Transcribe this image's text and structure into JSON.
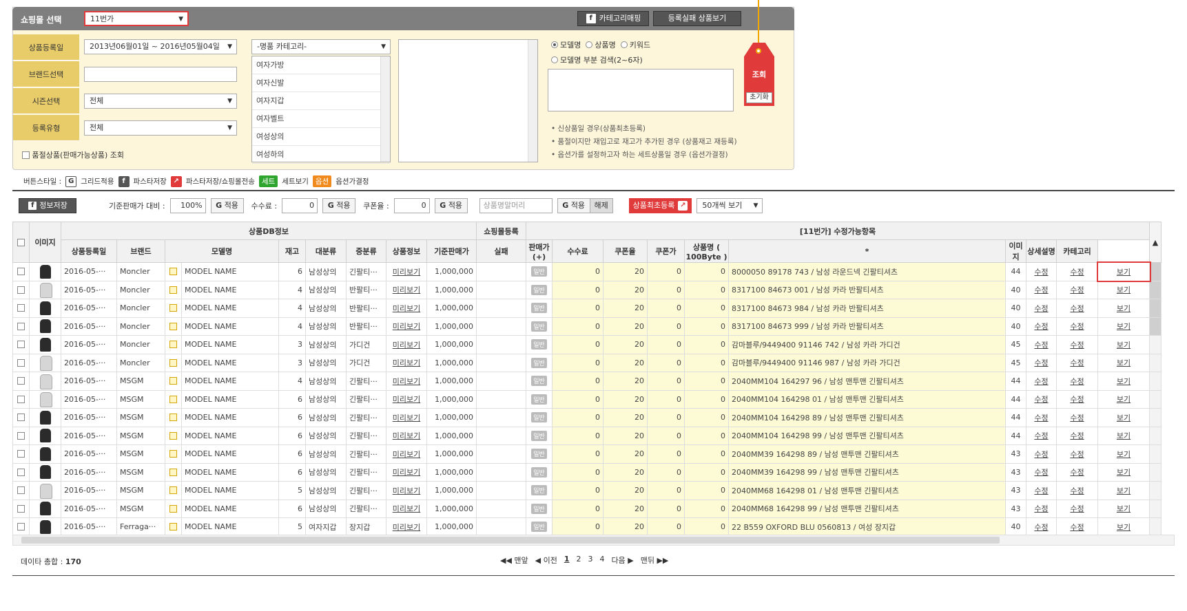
{
  "top": {
    "shop_label": "쇼핑몰 선택",
    "shop_value": "11번가",
    "btn_category_mapping": "카테고리매핑",
    "btn_reg_fail": "등록실패 상품보기",
    "reg_date_label": "상품등록일",
    "reg_date_value": "2013년06월01일 ~ 2016년05월04일",
    "brand_label": "브랜드선택",
    "season_label": "시즌선택",
    "season_value": "전체",
    "regtype_label": "등록유형",
    "regtype_value": "전체",
    "soldout_label": "품절상품(판매가능상품) 조회",
    "category_select": "-명품 카테고리-",
    "category_items": [
      "여자가방",
      "여자신발",
      "여자지갑",
      "여자벨트",
      "여성상의",
      "여성하의"
    ],
    "radio_model": "모델명",
    "radio_product": "상품명",
    "radio_keyword": "키워드",
    "radio_partial": "모델명 부분 검색(2~6자)",
    "search_btn": "조회",
    "reset_btn": "초기화",
    "notes": [
      "신상품일 경우(상품최초등록)",
      "품절이지만 재입고로 재고가 추가된 경우 (상품재고 재등록)",
      "옵션가를 설정하고자 하는 세트상품일 경우 (옵션가결정)"
    ]
  },
  "legend": {
    "title": "버튼스타일 :",
    "grid_apply": "그리드적용",
    "pasta_save": "파스타저장",
    "pasta_send": "파스타저장/쇼핑몰전송",
    "set_badge": "세트",
    "set_view": "세트보기",
    "option_badge": "옵션",
    "option_set": "옵션가결정"
  },
  "toolbar": {
    "save_info": "정보저장",
    "base_price_label": "기준판매가 대비 :",
    "base_price_value": "100%",
    "apply": "적용",
    "fee_label": "수수료 :",
    "fee_value": "0",
    "coupon_label": "쿠폰율 :",
    "coupon_value": "0",
    "prefix_placeholder": "상품명말머리",
    "release": "해제",
    "first_reg": "상품최초등록",
    "per_page": "50개씩 보기"
  },
  "grid": {
    "group_db": "상품DB정보",
    "group_mall": "쇼핑몰등록",
    "group_editable": "[11번가] 수정가능항목",
    "col_image": "이미지",
    "columns": [
      "상품등록일",
      "브랜드",
      "모델명",
      "재고",
      "대분류",
      "중분류",
      "상품정보",
      "기준판매가",
      "실패",
      "판매가(+)",
      "수수료",
      "쿠폰율",
      "쿠폰가",
      "상품명 ( 100Byte )",
      "*",
      "이미지",
      "상세설명",
      "카테고리"
    ],
    "rows": [
      {
        "date": "2016-05-···",
        "brand": "Moncler",
        "model": "MODEL NAME",
        "stock": "6",
        "cat1": "남성상의",
        "cat2": "긴팔티···",
        "info": "미리보기",
        "price": "1,000,000",
        "badge": "일반",
        "sale": "0",
        "fee": "20",
        "coupon": "0",
        "cprice": "0",
        "name": "8000050 89178 743 / 남성 라운드넥 긴팔티셔츠",
        "star": "44",
        "img": "수정",
        "desc": "수정",
        "cat": "보기",
        "thumb": "dark"
      },
      {
        "date": "2016-05-···",
        "brand": "Moncler",
        "model": "MODEL NAME",
        "stock": "4",
        "cat1": "남성상의",
        "cat2": "반팔티···",
        "info": "미리보기",
        "price": "1,000,000",
        "badge": "일반",
        "sale": "0",
        "fee": "20",
        "coupon": "0",
        "cprice": "0",
        "name": "8317100 84673 001 / 남성 카라 반팔티셔츠",
        "star": "40",
        "img": "수정",
        "desc": "수정",
        "cat": "보기",
        "thumb": "light"
      },
      {
        "date": "2016-05-···",
        "brand": "Moncler",
        "model": "MODEL NAME",
        "stock": "4",
        "cat1": "남성상의",
        "cat2": "반팔티···",
        "info": "미리보기",
        "price": "1,000,000",
        "badge": "일반",
        "sale": "0",
        "fee": "20",
        "coupon": "0",
        "cprice": "0",
        "name": "8317100 84673 984 / 남성 카라 반팔티셔츠",
        "star": "40",
        "img": "수정",
        "desc": "수정",
        "cat": "보기",
        "thumb": "dark"
      },
      {
        "date": "2016-05-···",
        "brand": "Moncler",
        "model": "MODEL NAME",
        "stock": "4",
        "cat1": "남성상의",
        "cat2": "반팔티···",
        "info": "미리보기",
        "price": "1,000,000",
        "badge": "일반",
        "sale": "0",
        "fee": "20",
        "coupon": "0",
        "cprice": "0",
        "name": "8317100 84673 999 / 남성 카라 반팔티셔츠",
        "star": "40",
        "img": "수정",
        "desc": "수정",
        "cat": "보기",
        "thumb": "dark"
      },
      {
        "date": "2016-05-···",
        "brand": "Moncler",
        "model": "MODEL NAME",
        "stock": "3",
        "cat1": "남성상의",
        "cat2": "가디건",
        "info": "미리보기",
        "price": "1,000,000",
        "badge": "일반",
        "sale": "0",
        "fee": "20",
        "coupon": "0",
        "cprice": "0",
        "name": "감마블루/9449400 91146 742 / 남성 카라 가디건",
        "star": "45",
        "img": "수정",
        "desc": "수정",
        "cat": "보기",
        "thumb": "dark"
      },
      {
        "date": "2016-05-···",
        "brand": "Moncler",
        "model": "MODEL NAME",
        "stock": "3",
        "cat1": "남성상의",
        "cat2": "가디건",
        "info": "미리보기",
        "price": "1,000,000",
        "badge": "일반",
        "sale": "0",
        "fee": "20",
        "coupon": "0",
        "cprice": "0",
        "name": "감마블루/9449400 91146 987 / 남성 카라 가디건",
        "star": "45",
        "img": "수정",
        "desc": "수정",
        "cat": "보기",
        "thumb": "light"
      },
      {
        "date": "2016-05-···",
        "brand": "MSGM",
        "model": "MODEL NAME",
        "stock": "4",
        "cat1": "남성상의",
        "cat2": "긴팔티···",
        "info": "미리보기",
        "price": "1,000,000",
        "badge": "일반",
        "sale": "0",
        "fee": "20",
        "coupon": "0",
        "cprice": "0",
        "name": "2040MM104 164297 96 / 남성 맨투맨 긴팔티셔츠",
        "star": "44",
        "img": "수정",
        "desc": "수정",
        "cat": "보기",
        "thumb": "light"
      },
      {
        "date": "2016-05-···",
        "brand": "MSGM",
        "model": "MODEL NAME",
        "stock": "6",
        "cat1": "남성상의",
        "cat2": "긴팔티···",
        "info": "미리보기",
        "price": "1,000,000",
        "badge": "일반",
        "sale": "0",
        "fee": "20",
        "coupon": "0",
        "cprice": "0",
        "name": "2040MM104 164298 01 / 남성 맨투맨 긴팔티셔츠",
        "star": "44",
        "img": "수정",
        "desc": "수정",
        "cat": "보기",
        "thumb": "light"
      },
      {
        "date": "2016-05-···",
        "brand": "MSGM",
        "model": "MODEL NAME",
        "stock": "6",
        "cat1": "남성상의",
        "cat2": "긴팔티···",
        "info": "미리보기",
        "price": "1,000,000",
        "badge": "일반",
        "sale": "0",
        "fee": "20",
        "coupon": "0",
        "cprice": "0",
        "name": "2040MM104 164298 89 / 남성 맨투맨 긴팔티셔츠",
        "star": "44",
        "img": "수정",
        "desc": "수정",
        "cat": "보기",
        "thumb": "dark"
      },
      {
        "date": "2016-05-···",
        "brand": "MSGM",
        "model": "MODEL NAME",
        "stock": "6",
        "cat1": "남성상의",
        "cat2": "긴팔티···",
        "info": "미리보기",
        "price": "1,000,000",
        "badge": "일반",
        "sale": "0",
        "fee": "20",
        "coupon": "0",
        "cprice": "0",
        "name": "2040MM104 164298 99 / 남성 맨투맨 긴팔티셔츠",
        "star": "44",
        "img": "수정",
        "desc": "수정",
        "cat": "보기",
        "thumb": "dark"
      },
      {
        "date": "2016-05-···",
        "brand": "MSGM",
        "model": "MODEL NAME",
        "stock": "6",
        "cat1": "남성상의",
        "cat2": "긴팔티···",
        "info": "미리보기",
        "price": "1,000,000",
        "badge": "일반",
        "sale": "0",
        "fee": "20",
        "coupon": "0",
        "cprice": "0",
        "name": "2040MM39 164298 89 / 남성 맨투맨 긴팔티셔츠",
        "star": "43",
        "img": "수정",
        "desc": "수정",
        "cat": "보기",
        "thumb": "dark"
      },
      {
        "date": "2016-05-···",
        "brand": "MSGM",
        "model": "MODEL NAME",
        "stock": "6",
        "cat1": "남성상의",
        "cat2": "긴팔티···",
        "info": "미리보기",
        "price": "1,000,000",
        "badge": "일반",
        "sale": "0",
        "fee": "20",
        "coupon": "0",
        "cprice": "0",
        "name": "2040MM39 164298 99 / 남성 맨투맨 긴팔티셔츠",
        "star": "43",
        "img": "수정",
        "desc": "수정",
        "cat": "보기",
        "thumb": "dark"
      },
      {
        "date": "2016-05-···",
        "brand": "MSGM",
        "model": "MODEL NAME",
        "stock": "5",
        "cat1": "남성상의",
        "cat2": "긴팔티···",
        "info": "미리보기",
        "price": "1,000,000",
        "badge": "일반",
        "sale": "0",
        "fee": "20",
        "coupon": "0",
        "cprice": "0",
        "name": "2040MM68 164298 01 / 남성 맨투맨 긴팔티셔츠",
        "star": "43",
        "img": "수정",
        "desc": "수정",
        "cat": "보기",
        "thumb": "light"
      },
      {
        "date": "2016-05-···",
        "brand": "MSGM",
        "model": "MODEL NAME",
        "stock": "6",
        "cat1": "남성상의",
        "cat2": "긴팔티···",
        "info": "미리보기",
        "price": "1,000,000",
        "badge": "일반",
        "sale": "0",
        "fee": "20",
        "coupon": "0",
        "cprice": "0",
        "name": "2040MM68 164298 99 / 남성 맨투맨 긴팔티셔츠",
        "star": "43",
        "img": "수정",
        "desc": "수정",
        "cat": "보기",
        "thumb": "dark"
      },
      {
        "date": "2016-05-···",
        "brand": "Ferraga···",
        "model": "MODEL NAME",
        "stock": "5",
        "cat1": "여자지갑",
        "cat2": "장지갑",
        "info": "미리보기",
        "price": "1,000,000",
        "badge": "일반",
        "sale": "0",
        "fee": "20",
        "coupon": "0",
        "cprice": "0",
        "name": "22 B559 OXFORD BLU 0560813 / 여성 장지갑",
        "star": "40",
        "img": "수정",
        "desc": "수정",
        "cat": "보기",
        "thumb": "dark"
      }
    ]
  },
  "footer": {
    "total_label": "데이타 총합 :",
    "total_value": "170",
    "first": "◀◀ 맨앞",
    "prev": "◀ 이전",
    "pages": [
      "1",
      "2",
      "3",
      "4"
    ],
    "next": "다음 ▶",
    "last": "맨뒤 ▶▶"
  },
  "colors": {
    "accent_red": "#e03a3a",
    "label_gold": "#e8cc6a",
    "panel_bg": "#fdf6da"
  }
}
